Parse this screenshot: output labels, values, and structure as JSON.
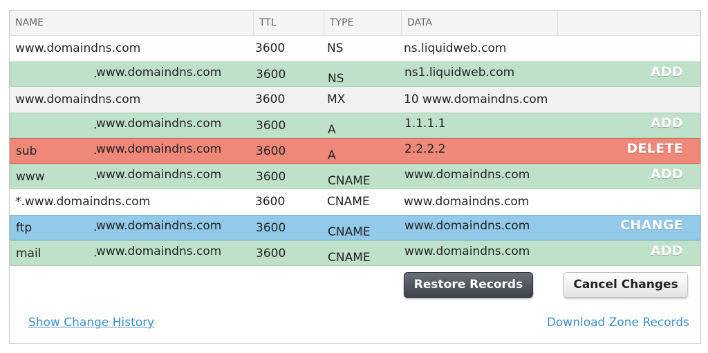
{
  "table": {
    "headers": [
      "NAME",
      "TTL",
      "TYPE",
      "DATA",
      ""
    ],
    "rows": [
      {
        "name": "www.domaindns.com",
        "host": "",
        "ttl": "3600",
        "type": "NS",
        "data": "ns.liquidweb.com",
        "action": ""
      },
      {
        "name": "",
        "host": "www.domaindns.com",
        "ttl": "3600",
        "type": "NS",
        "data": "ns1.liquidweb.com",
        "action": "ADD"
      },
      {
        "name": "www.domaindns.com",
        "host": "",
        "ttl": "3600",
        "type": "MX",
        "data": "10 www.domaindns.com",
        "action": ""
      },
      {
        "name": "",
        "host": "www.domaindns.com",
        "ttl": "3600",
        "type": "A",
        "data": "1.1.1.1",
        "action": "ADD"
      },
      {
        "name": "sub",
        "host": "www.domaindns.com",
        "ttl": "3600",
        "type": "A",
        "data": "2.2.2.2",
        "action": "DELETE"
      },
      {
        "name": "www",
        "host": "www.domaindns.com",
        "ttl": "3600",
        "type": "CNAME",
        "data": "www.domaindns.com",
        "action": "ADD"
      },
      {
        "name": "*.www.domaindns.com",
        "host": "",
        "ttl": "3600",
        "type": "CNAME",
        "data": "www.domaindns.com",
        "action": ""
      },
      {
        "name": "ftp",
        "host": "www.domaindns.com",
        "ttl": "3600",
        "type": "CNAME",
        "data": "www.domaindns.com",
        "action": "CHANGE"
      },
      {
        "name": "mail",
        "host": "www.domaindns.com",
        "ttl": "3600",
        "type": "CNAME",
        "data": "www.domaindns.com",
        "action": "ADD"
      }
    ]
  },
  "buttons": {
    "restore": "Restore Records",
    "cancel": "Cancel Changes"
  },
  "links": {
    "history": "Show Change History",
    "download": "Download Zone Records"
  },
  "colors": {
    "add": "#bfe1c9",
    "delete": "#ee8878",
    "change": "#93c9e9",
    "link": "#3a8fc9"
  }
}
